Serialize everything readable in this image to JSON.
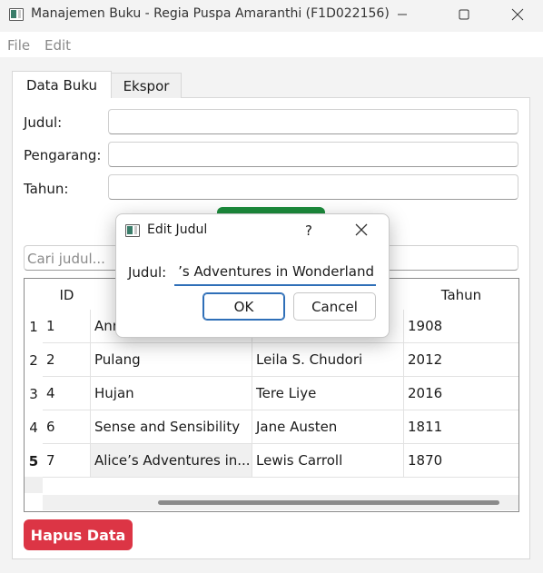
{
  "window": {
    "title": "Manajemen Buku - Regia Puspa Amaranthi (F1D022156)",
    "icon": "app-window-icon",
    "controls": [
      "minimize-icon",
      "maximize-icon",
      "close-icon"
    ]
  },
  "menu": {
    "file": "File",
    "edit": "Edit"
  },
  "tabs": {
    "data_buku": "Data Buku",
    "ekspor": "Ekspor",
    "active": "Data Buku"
  },
  "form": {
    "judul_label": "Judul:",
    "pengarang_label": "Pengarang:",
    "tahun_label": "Tahun:",
    "judul_value": "",
    "pengarang_value": "",
    "tahun_value": ""
  },
  "search": {
    "placeholder": "Cari judul..."
  },
  "table": {
    "headers": {
      "id": "ID",
      "judul": "",
      "pengarang": "",
      "tahun": "Tahun"
    },
    "rows": [
      {
        "num": "1",
        "id": "1",
        "judul": "Ann",
        "pengarang": "",
        "tahun": "1908"
      },
      {
        "num": "2",
        "id": "2",
        "judul": "Pulang",
        "pengarang": "Leila S. Chudori",
        "tahun": "2012"
      },
      {
        "num": "3",
        "id": "4",
        "judul": "Hujan",
        "pengarang": "Tere Liye",
        "tahun": "2016"
      },
      {
        "num": "4",
        "id": "6",
        "judul": "Sense and Sensibility",
        "pengarang": "Jane Austen",
        "tahun": "1811"
      },
      {
        "num": "5",
        "id": "7",
        "judul": "Alice’s Adventures in...",
        "pengarang": "Lewis Carroll",
        "tahun": "1870"
      }
    ],
    "selected_row": "5"
  },
  "buttons": {
    "delete": "Hapus Data"
  },
  "colors": {
    "delete": "#dc3545",
    "add": "#1c8c3c",
    "focus": "#2f6fb8"
  },
  "dialog": {
    "title": "Edit Judul",
    "help": "?",
    "label": "Judul:",
    "value": "’s Adventures in Wonderland",
    "ok": "OK",
    "cancel": "Cancel"
  }
}
